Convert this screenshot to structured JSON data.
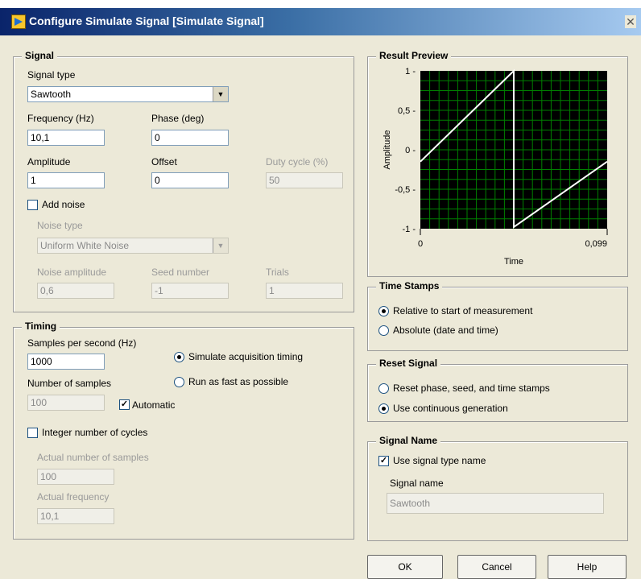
{
  "window": {
    "title": "Configure Simulate Signal [Simulate Signal]",
    "close_icon": "close-icon"
  },
  "signal": {
    "title": "Signal",
    "signal_type_label": "Signal type",
    "signal_type_value": "Sawtooth",
    "frequency_label": "Frequency (Hz)",
    "frequency_value": "10,1",
    "phase_label": "Phase (deg)",
    "phase_value": "0",
    "amplitude_label": "Amplitude",
    "amplitude_value": "1",
    "offset_label": "Offset",
    "offset_value": "0",
    "duty_cycle_label": "Duty cycle (%)",
    "duty_cycle_value": "50",
    "add_noise_label": "Add noise",
    "add_noise_checked": false,
    "noise_type_label": "Noise type",
    "noise_type_value": "Uniform White Noise",
    "noise_amplitude_label": "Noise amplitude",
    "noise_amplitude_value": "0,6",
    "seed_number_label": "Seed number",
    "seed_number_value": "-1",
    "trials_label": "Trials",
    "trials_value": "1"
  },
  "timing": {
    "title": "Timing",
    "samples_per_second_label": "Samples per second (Hz)",
    "samples_per_second_value": "1000",
    "simulate_acquisition_label": "Simulate acquisition timing",
    "run_fast_label": "Run as fast as possible",
    "number_of_samples_label": "Number of samples",
    "number_of_samples_value": "100",
    "automatic_label": "Automatic",
    "automatic_checked": true,
    "integer_cycles_label": "Integer number of cycles",
    "integer_cycles_checked": false,
    "actual_samples_label": "Actual number of samples",
    "actual_samples_value": "100",
    "actual_frequency_label": "Actual frequency",
    "actual_frequency_value": "10,1"
  },
  "result_preview": {
    "title": "Result Preview",
    "ylabel": "Amplitude",
    "xlabel": "Time",
    "y_ticks": [
      "1",
      "0,5",
      "0",
      "-0,5",
      "-1"
    ],
    "x_ticks": [
      "0",
      "0,099"
    ]
  },
  "chart_data": {
    "type": "line",
    "xlabel": "Time",
    "ylabel": "Amplitude",
    "xlim": [
      0,
      0.099
    ],
    "ylim": [
      -1,
      1
    ],
    "series": [
      {
        "x": [
          0,
          0.0495,
          0.0495,
          0.099
        ],
        "y": [
          -0.15,
          1,
          -0.98,
          -0.15
        ]
      }
    ],
    "colors": {
      "background": "#000000",
      "grid": "#008000",
      "line": "#ffffff"
    }
  },
  "time_stamps": {
    "title": "Time Stamps",
    "relative_label": "Relative to start of measurement",
    "absolute_label": "Absolute (date and time)"
  },
  "reset_signal": {
    "title": "Reset Signal",
    "reset_label": "Reset phase, seed, and time stamps",
    "continuous_label": "Use continuous generation"
  },
  "signal_name": {
    "title": "Signal Name",
    "use_type_name_label": "Use signal type name",
    "use_type_name_checked": true,
    "name_label": "Signal name",
    "name_value": "Sawtooth"
  },
  "buttons": {
    "ok": "OK",
    "cancel": "Cancel",
    "help": "Help"
  }
}
